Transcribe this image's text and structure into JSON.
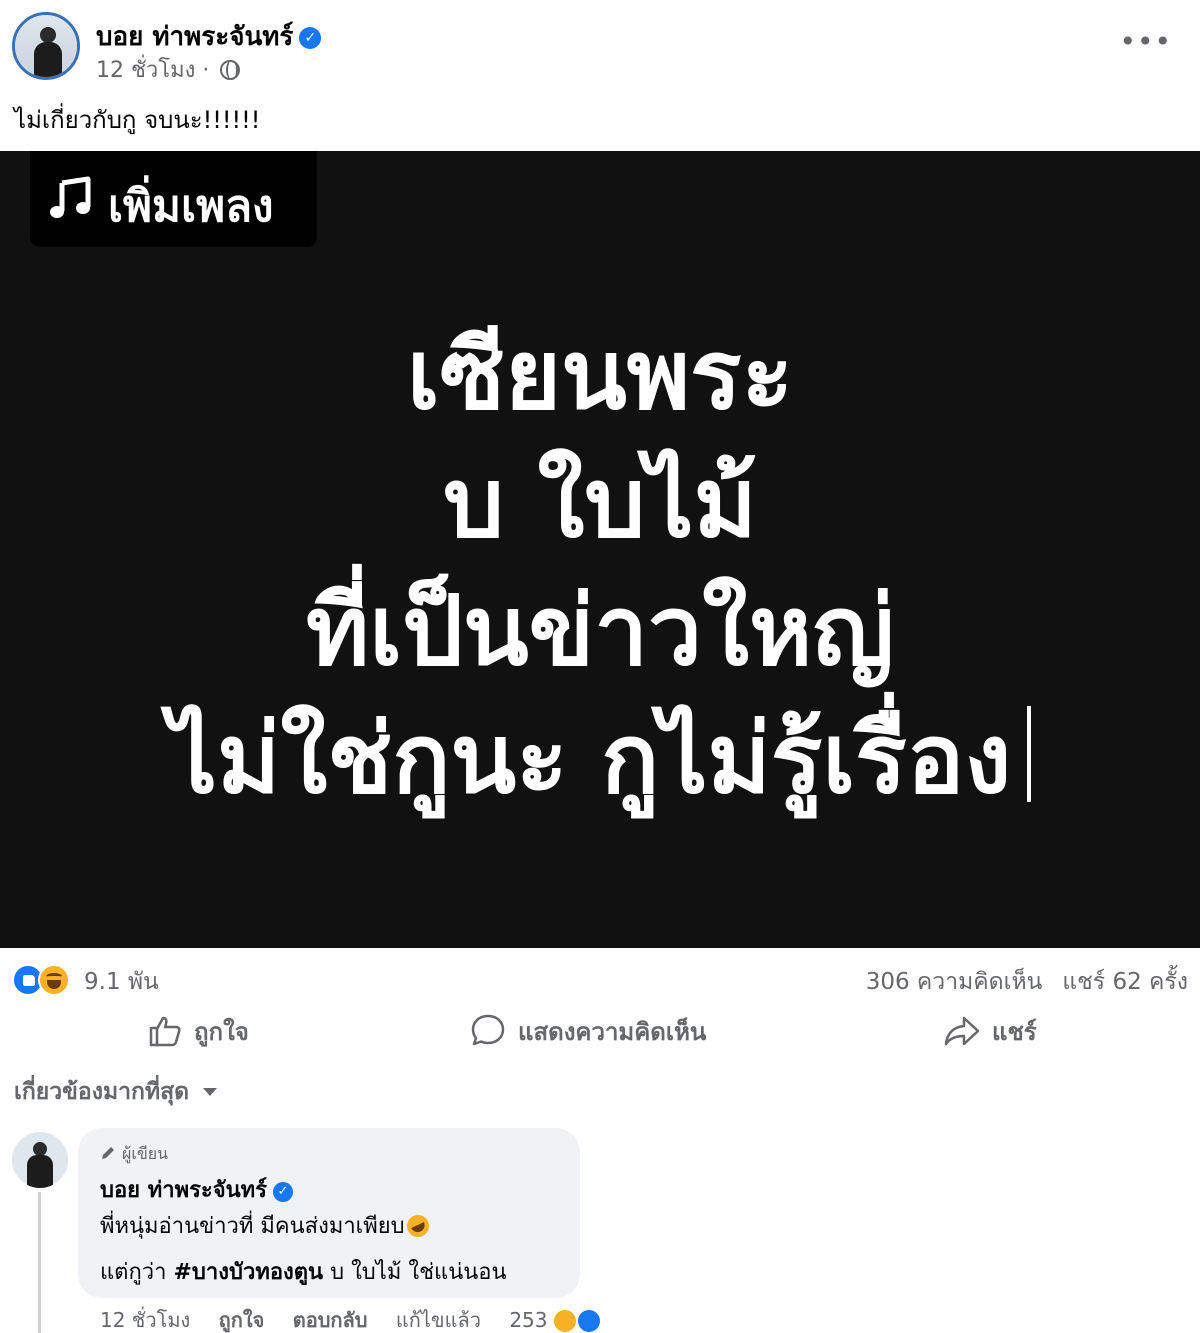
{
  "post": {
    "author_name": "บอย ท่าพระจันทร์",
    "time": "12 ชั่วโมง ·",
    "text": "ไม่เกี่ยวกับกู จบนะ!!!!!!"
  },
  "media": {
    "music_label": "เพิ่มเพลง",
    "lines": [
      "เซียนพระ",
      "บ ใบไม้",
      "ที่เป็นข่าวใหญ่",
      "ไม่ใช่กูนะ กูไม่รู้เรื่อง"
    ]
  },
  "stats": {
    "reactions_count": "9.1 พัน",
    "comments": "306 ความคิดเห็น",
    "shares": "แชร์ 62 ครั้ง"
  },
  "actions": {
    "like": "ถูกใจ",
    "comment": "แสดงความคิดเห็น",
    "share": "แชร์"
  },
  "sort_label": "เกี่ยวข้องมากที่สุด",
  "comment": {
    "badge": "ผู้เขียน",
    "author_name": "บอย ท่าพระจันทร์",
    "line1": "พี่หนุ่มอ่านข่าวที่ มีคนส่งมาเพียบ",
    "line2_prefix": "แต่กูว่า",
    "hashtag": "#บางบัวทองตูน",
    "line2_suffix": "บ ใบไม้ ใช่แน่นอน",
    "time": "12 ชั่วโมง",
    "like": "ถูกใจ",
    "reply": "ตอบกลับ",
    "edited": "แก้ไขแล้ว",
    "reaction_count": "253"
  },
  "colors": {
    "accent": "#1877f2",
    "secondary_text": "#65676b",
    "bubble": "#f0f2f5",
    "media_bg": "#111111"
  },
  "icons": [
    "verified-icon",
    "globe-icon",
    "more-icon",
    "music-note-icon",
    "like-reaction-icon",
    "haha-reaction-icon",
    "thumbs-up-icon",
    "comment-icon",
    "share-icon",
    "pencil-icon",
    "caret-down-icon"
  ]
}
